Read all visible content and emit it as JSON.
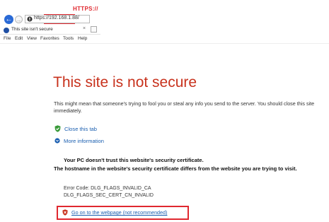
{
  "annotation": {
    "label": "HTTPS://"
  },
  "browser": {
    "address": "https://192.168.1.88/",
    "tab_title": "This site isn't secure",
    "tab_close": "×",
    "back_glyph": "←",
    "forward_glyph": "→",
    "menu": [
      "File",
      "Edit",
      "View",
      "Favorites",
      "Tools",
      "Help"
    ]
  },
  "page": {
    "heading": "This site is not secure",
    "description": "This might mean that someone's trying to fool you or steal any info you send to the server. You should close this site immediately.",
    "close_tab_link": "Close this tab",
    "more_info_link": "More information",
    "trust_line1": "Your PC doesn't trust this website's security certificate.",
    "trust_line2": "The hostname in the website's security certificate differs from the website you are trying to visit.",
    "error_code1": "Error Code: DLG_FLAGS_INVALID_CA",
    "error_code2": "DLG_FLAGS_SEC_CERT_CN_INVALID",
    "proceed_link": "Go on to the webpage (not recommended)"
  },
  "colors": {
    "accent_red": "#e0282f",
    "heading_red": "#c8321d",
    "link_blue": "#1b5fb0"
  },
  "icons": [
    "back-arrow-icon",
    "forward-arrow-icon",
    "certificate-error-icon",
    "ie-favicon-icon",
    "green-shield-icon",
    "info-chevron-icon",
    "red-shield-icon"
  ]
}
